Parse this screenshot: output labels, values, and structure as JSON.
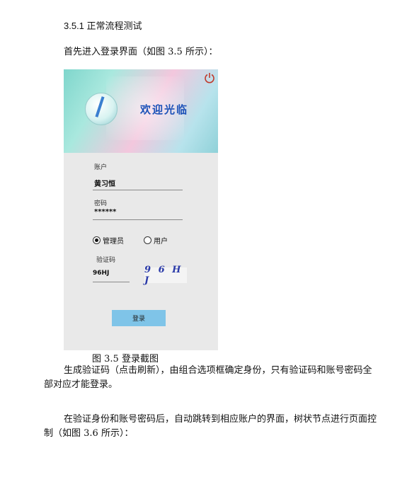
{
  "section_title": "3.5.1 正常流程测试",
  "intro": "首先进入登录界面（如图 3.5 所示）：",
  "login_screen": {
    "welcome_text": "欢迎光临",
    "account_label": "账户",
    "account_value": "黄习恒",
    "password_label": "密码",
    "password_value": "******",
    "roles": [
      {
        "label": "管理员",
        "selected": true
      },
      {
        "label": "用户",
        "selected": false
      }
    ],
    "captcha_label": "验证码",
    "captcha_input": "96HJ",
    "captcha_image_text": "9 6 H J",
    "login_button": "登录",
    "icons": {
      "power": "power-icon",
      "logo": "app-logo"
    }
  },
  "caption": "图 3.5 登录截图",
  "paragraph_1": "生成验证码（点击刷新），由组合选项框确定身份，只有验证码和账号密码全部对应才能登录。",
  "paragraph_2": "在验证身份和账号密码后，自动跳转到相应账户的界面，树状节点进行页面控制（如图 3.6 所示）："
}
